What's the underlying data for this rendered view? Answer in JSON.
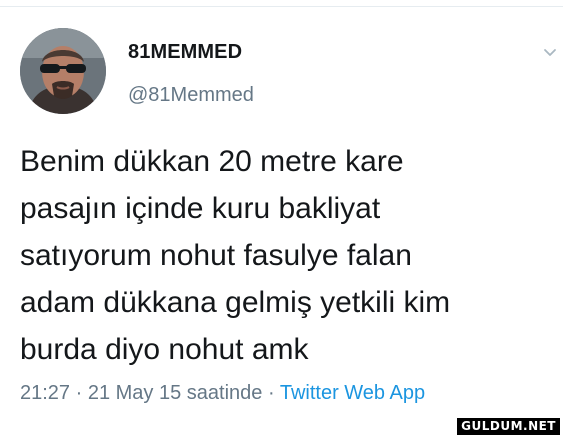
{
  "tweet": {
    "author": {
      "display_name": "81MEMMED",
      "handle": "@81Memmed"
    },
    "text": "Benim dükkan 20 metre kare\npasajın içinde kuru bakliyat\nsatıyorum nohut fasulye falan\nadam dükkana gelmiş yetkili kim\nburda diyo nohut amk",
    "time": "21:27",
    "separator_1": " · ",
    "date": "21 May 15 saatinde",
    "separator_2": " · ",
    "source": "Twitter Web App"
  },
  "icons": {
    "avatar": "profile-photo",
    "menu": "chevron-down-icon"
  },
  "watermark": {
    "text": "GULDUM.NET"
  },
  "colors": {
    "text": "#14171a",
    "secondary": "#657786",
    "link": "#1b95e0"
  }
}
